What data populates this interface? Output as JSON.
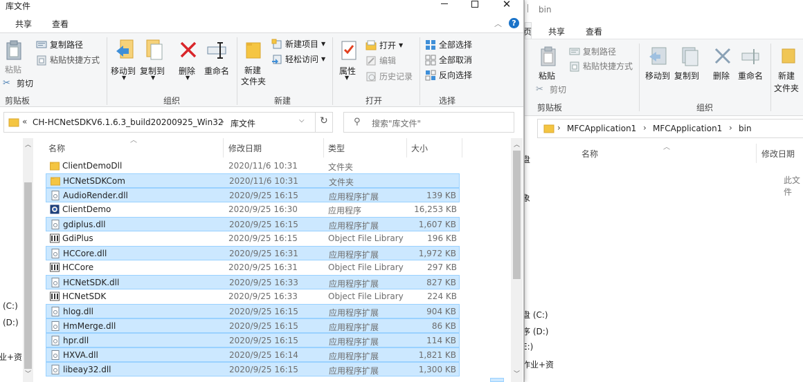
{
  "win1": {
    "title": "库文件",
    "tabs": [
      "共享",
      "查看"
    ],
    "ribbon": {
      "clipboard": {
        "paste": "粘贴",
        "copy_path": "复制路径",
        "paste_shortcut": "粘贴快捷方式",
        "cut": "剪切",
        "label": "剪贴板"
      },
      "organize": {
        "move_to": "移动到",
        "copy_to": "复制到",
        "delete": "删除",
        "rename": "重命名",
        "label": "组织"
      },
      "new": {
        "new_folder": "新建\n文件夹",
        "new_folder_l1": "新建",
        "new_folder_l2": "文件夹",
        "new_item": "新建项目",
        "easy_access": "轻松访问",
        "label": "新建"
      },
      "open": {
        "properties": "属性",
        "open": "打开",
        "edit": "编辑",
        "history": "历史记录",
        "label": "打开"
      },
      "select": {
        "select_all": "全部选择",
        "select_none": "全部取消",
        "invert": "反向选择",
        "label": "选择"
      }
    },
    "address": {
      "chevron": "«",
      "path": [
        "CH-HCNetSDKV6.1.6.3_build20200925_Win32",
        "库文件"
      ]
    },
    "search_placeholder": "搜索\"库文件\"",
    "columns": {
      "name": "名称",
      "date": "修改日期",
      "type": "类型",
      "size": "大小"
    },
    "nav_labels": [
      "(C:)",
      "(D:)",
      "业+资"
    ],
    "files": [
      {
        "name": "ClientDemoDll",
        "date": "2020/11/6 10:31",
        "type": "文件夹",
        "size": "",
        "icon": "folder",
        "selected": false
      },
      {
        "name": "HCNetSDKCom",
        "date": "2020/11/6 10:31",
        "type": "文件夹",
        "size": "",
        "icon": "folder",
        "selected": true
      },
      {
        "name": "AudioRender.dll",
        "date": "2020/9/25 16:15",
        "type": "应用程序扩展",
        "size": "139 KB",
        "icon": "dll",
        "selected": true
      },
      {
        "name": "ClientDemo",
        "date": "2020/9/25 16:30",
        "type": "应用程序",
        "size": "16,253 KB",
        "icon": "exe",
        "selected": false
      },
      {
        "name": "gdiplus.dll",
        "date": "2020/9/25 16:15",
        "type": "应用程序扩展",
        "size": "1,607 KB",
        "icon": "dll",
        "selected": true
      },
      {
        "name": "GdiPlus",
        "date": "2020/9/25 16:15",
        "type": "Object File Library",
        "size": "196 KB",
        "icon": "lib",
        "selected": false
      },
      {
        "name": "HCCore.dll",
        "date": "2020/9/25 16:31",
        "type": "应用程序扩展",
        "size": "1,972 KB",
        "icon": "dll",
        "selected": true
      },
      {
        "name": "HCCore",
        "date": "2020/9/25 16:31",
        "type": "Object File Library",
        "size": "297 KB",
        "icon": "lib",
        "selected": false
      },
      {
        "name": "HCNetSDK.dll",
        "date": "2020/9/25 16:33",
        "type": "应用程序扩展",
        "size": "827 KB",
        "icon": "dll",
        "selected": true
      },
      {
        "name": "HCNetSDK",
        "date": "2020/9/25 16:33",
        "type": "Object File Library",
        "size": "224 KB",
        "icon": "lib",
        "selected": false
      },
      {
        "name": "hlog.dll",
        "date": "2020/9/25 16:15",
        "type": "应用程序扩展",
        "size": "904 KB",
        "icon": "dll",
        "selected": true
      },
      {
        "name": "HmMerge.dll",
        "date": "2020/9/25 16:15",
        "type": "应用程序扩展",
        "size": "86 KB",
        "icon": "dll",
        "selected": true
      },
      {
        "name": "hpr.dll",
        "date": "2020/9/25 16:15",
        "type": "应用程序扩展",
        "size": "114 KB",
        "icon": "dll",
        "selected": true
      },
      {
        "name": "HXVA.dll",
        "date": "2020/9/25 16:14",
        "type": "应用程序扩展",
        "size": "1,821 KB",
        "icon": "dll",
        "selected": true
      },
      {
        "name": "libeay32.dll",
        "date": "2020/9/25 16:15",
        "type": "应用程序扩展",
        "size": "1,300 KB",
        "icon": "dll",
        "selected": true
      }
    ]
  },
  "win2": {
    "title": "bin",
    "tabs": [
      "页",
      "共享",
      "查看"
    ],
    "ribbon": {
      "paste": "粘贴",
      "copy_path": "复制路径",
      "paste_shortcut": "粘贴快捷方式",
      "cut": "剪切",
      "clipboard_label": "剪贴板",
      "move_to": "移动到",
      "copy_to": "复制到",
      "delete": "删除",
      "rename": "重命名",
      "organize_label": "组织",
      "new_l1": "新建",
      "new_l2": "文件夹"
    },
    "address": [
      "MFCApplication1",
      "MFCApplication1",
      "bin"
    ],
    "columns": {
      "name": "名称",
      "date": "修改日期"
    },
    "empty_text": "此文件",
    "nav_labels": [
      "盘",
      "象",
      "盘 (C:)",
      "序 (D:)",
      "E:)",
      "作业+资"
    ]
  }
}
